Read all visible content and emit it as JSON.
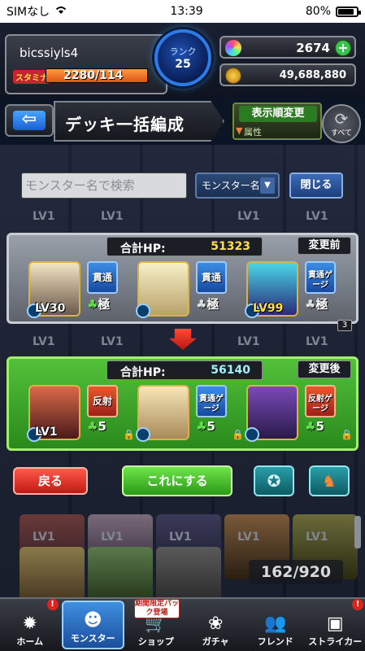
{
  "status_bar": {
    "carrier": "SIMなし",
    "time": "13:39",
    "battery": "80%"
  },
  "header": {
    "player_name": "bicssiyls4",
    "stamina_label": "スタミナ",
    "stamina_value": "2280/114",
    "rank_label": "ランク",
    "rank_value": "25",
    "orbs": "2674",
    "gold": "49,688,880"
  },
  "title_bar": {
    "title": "デッキ一括編成",
    "sort_button_label": "表示順変更",
    "sort_sub_label": "属性",
    "refresh_label": "すべて"
  },
  "search": {
    "placeholder": "モンスター名で検索",
    "select_value": "モンスター名",
    "close_label": "閉じる"
  },
  "before_panel": {
    "hp_label": "合計HP:",
    "hp_value": "51323",
    "state_label": "変更前",
    "slots": [
      {
        "lv": "LV30",
        "ability": "貫通",
        "plus": "極"
      },
      {
        "lv": "",
        "ability": "貫通",
        "plus": "極"
      },
      {
        "lv": "LV99",
        "ability": "貫通ゲージ",
        "plus": "極"
      }
    ],
    "badge": "3"
  },
  "after_panel": {
    "hp_label": "合計HP:",
    "hp_value": "56140",
    "state_label": "変更後",
    "slots": [
      {
        "lv": "LV1",
        "ability": "反射",
        "plus": "5"
      },
      {
        "lv": "",
        "ability": "貫通ゲージ",
        "plus": "5"
      },
      {
        "lv": "",
        "ability": "反射ゲージ",
        "plus": "5"
      }
    ]
  },
  "actions": {
    "back_label": "戻る",
    "confirm_label": "これにする"
  },
  "inventory_count": "162/920",
  "background_lv": "LV1",
  "bottom_nav": {
    "items": [
      {
        "label": "ホーム",
        "icon": "home-icon"
      },
      {
        "label": "モンスター",
        "icon": "monster-icon"
      },
      {
        "label": "ショップ",
        "icon": "cart-icon"
      },
      {
        "label": "ガチャ",
        "icon": "gacha-icon"
      },
      {
        "label": "フレンド",
        "icon": "friend-icon"
      },
      {
        "label": "ストライカー",
        "icon": "striker-icon"
      }
    ],
    "shop_badge": "期間限定パック登場"
  },
  "colors": {
    "before_panel": "#7d828b",
    "after_panel": "#3ca52a",
    "confirm_button": "#3cb628",
    "back_button": "#e0322a"
  }
}
